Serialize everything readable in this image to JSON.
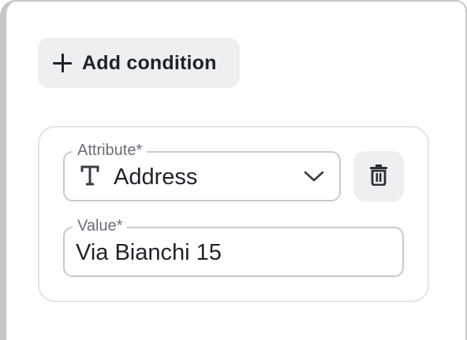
{
  "conditions": {
    "add_button_label": "Add condition",
    "add_icon": "plus-icon",
    "items": [
      {
        "attribute": {
          "label": "Attribute*",
          "selected_value": "Address",
          "type_icon": "text-type-icon",
          "dropdown_icon": "chevron-down-icon"
        },
        "delete_icon": "trash-icon",
        "value": {
          "label": "Value*",
          "current_value": "Via Bianchi 15"
        }
      }
    ]
  },
  "colors": {
    "button_bg": "#eeeff1",
    "text": "#1f2328",
    "muted_text": "#6a6e74",
    "border": "#c9cacd",
    "card_border": "#e3e4e7"
  }
}
